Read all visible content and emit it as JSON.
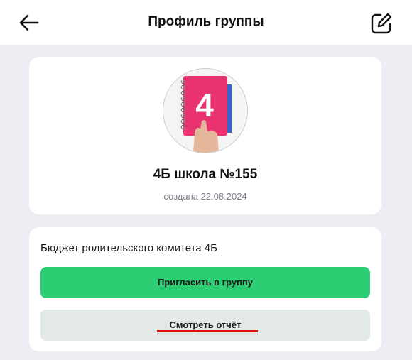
{
  "header": {
    "title": "Профиль группы",
    "back_icon": "arrow-left-icon",
    "edit_icon": "edit-icon"
  },
  "profile": {
    "avatar_number": "4",
    "group_name": "4Б школа №155",
    "created": "создана 22.08.2024"
  },
  "budget": {
    "label": "Бюджет родительского комитета 4Б",
    "invite_button": "Пригласить в группу",
    "report_button": "Смотреть отчёт"
  },
  "colors": {
    "accent_green": "#2dcd74",
    "secondary_button": "#e3e9e4",
    "underline_red": "#e20f0f",
    "page_background": "#eceef3"
  }
}
